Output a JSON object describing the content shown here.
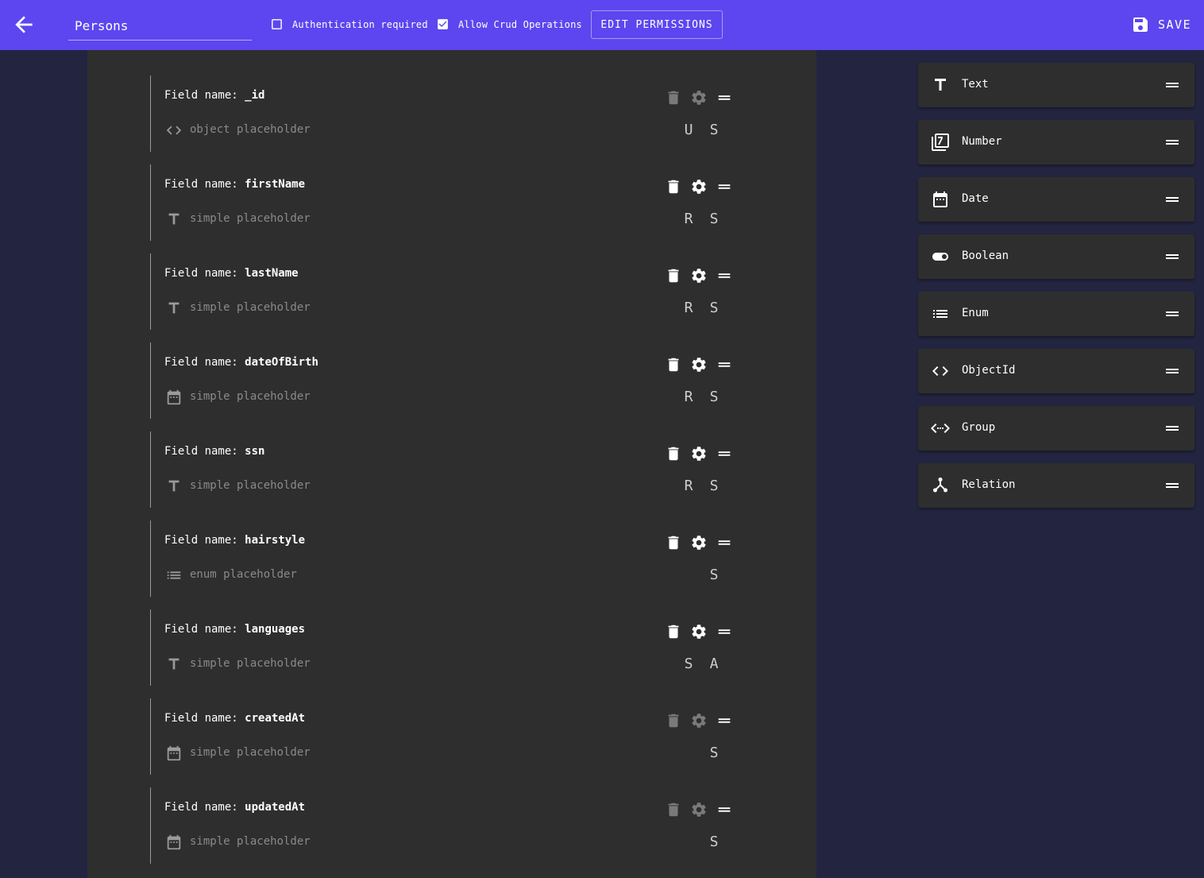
{
  "header": {
    "collection_name": "Persons",
    "auth_label": "Authentication required",
    "auth_checked": false,
    "crud_label": "Allow Crud Operations",
    "crud_checked": true,
    "edit_permissions_label": "EDIT PERMISSIONS",
    "save_label": "SAVE"
  },
  "fields_prefix": "Field name:",
  "fields": [
    {
      "name": "_id",
      "type_icon": "code-icon",
      "placeholder": "object placeholder",
      "flag1": "U",
      "flag2": "S",
      "enabled": false
    },
    {
      "name": "firstName",
      "type_icon": "text-icon",
      "placeholder": "simple placeholder",
      "flag1": "R",
      "flag2": "S",
      "enabled": true
    },
    {
      "name": "lastName",
      "type_icon": "text-icon",
      "placeholder": "simple placeholder",
      "flag1": "R",
      "flag2": "S",
      "enabled": true
    },
    {
      "name": "dateOfBirth",
      "type_icon": "calendar-icon",
      "placeholder": "simple placeholder",
      "flag1": "R",
      "flag2": "S",
      "enabled": true
    },
    {
      "name": "ssn",
      "type_icon": "text-icon",
      "placeholder": "simple placeholder",
      "flag1": "R",
      "flag2": "S",
      "enabled": true
    },
    {
      "name": "hairstyle",
      "type_icon": "list-icon",
      "placeholder": "enum placeholder",
      "flag1": "",
      "flag2": "S",
      "enabled": true
    },
    {
      "name": "languages",
      "type_icon": "text-icon",
      "placeholder": "simple placeholder",
      "flag1": "S",
      "flag2": "A",
      "enabled": true
    },
    {
      "name": "createdAt",
      "type_icon": "calendar-icon",
      "placeholder": "simple placeholder",
      "flag1": "",
      "flag2": "S",
      "enabled": false
    },
    {
      "name": "updatedAt",
      "type_icon": "calendar-icon",
      "placeholder": "simple placeholder",
      "flag1": "",
      "flag2": "S",
      "enabled": false
    }
  ],
  "palette": [
    {
      "label": "Text",
      "icon": "text-icon"
    },
    {
      "label": "Number",
      "icon": "number-icon"
    },
    {
      "label": "Date",
      "icon": "calendar-icon"
    },
    {
      "label": "Boolean",
      "icon": "toggle-icon"
    },
    {
      "label": "Enum",
      "icon": "list-icon"
    },
    {
      "label": "ObjectId",
      "icon": "code-icon"
    },
    {
      "label": "Group",
      "icon": "group-icon"
    },
    {
      "label": "Relation",
      "icon": "relation-icon"
    }
  ],
  "colors": {
    "header_bg": "#5d46ef",
    "page_bg": "#232440",
    "panel_bg": "#2e2e2e",
    "active_icon": "#ffffff",
    "disabled_icon": "#7a7a7a"
  }
}
